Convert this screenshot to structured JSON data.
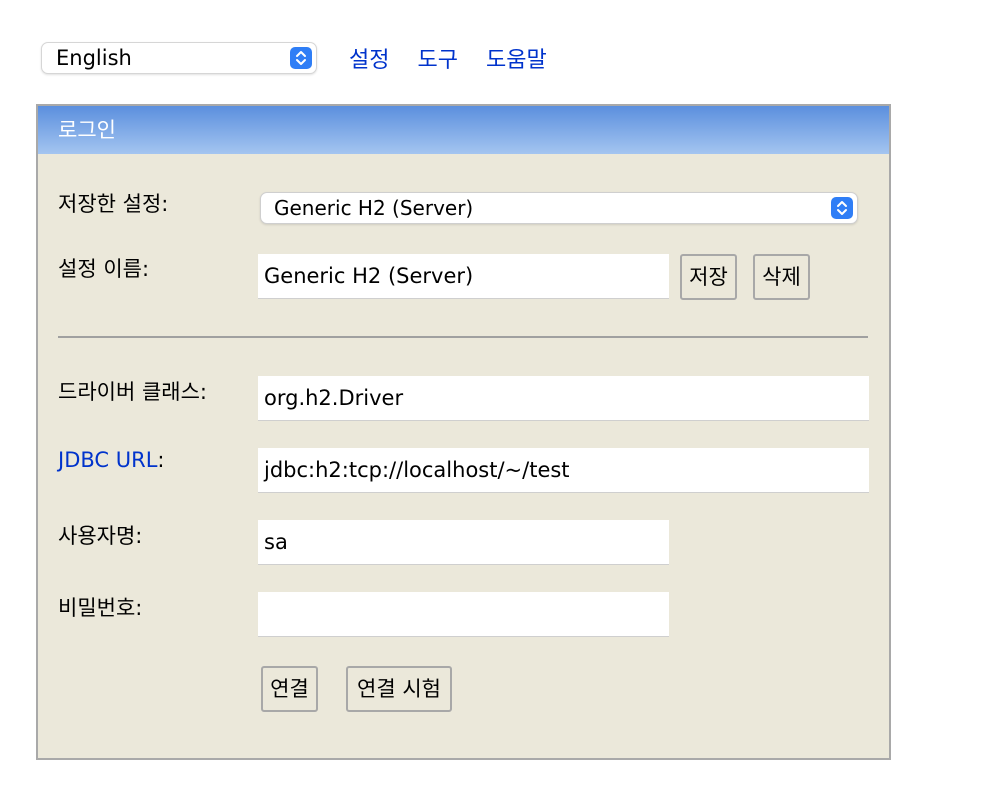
{
  "toolbar": {
    "language": "English",
    "links": [
      "설정",
      "도구",
      "도움말"
    ]
  },
  "panel": {
    "title": "로그인",
    "saved_settings_label": "저장한 설정:",
    "saved_settings_value": "Generic H2 (Server)",
    "setting_name_label": "설정 이름:",
    "setting_name_value": "Generic H2 (Server)",
    "save_button": "저장",
    "delete_button": "삭제",
    "driver_label": "드라이버 클래스:",
    "driver_value": "org.h2.Driver",
    "jdbc_url_label_link": "JDBC URL",
    "jdbc_url_label_suffix": ":",
    "jdbc_url_value": "jdbc:h2:tcp://localhost/~/test",
    "username_label": "사용자명:",
    "username_value": "sa",
    "password_label": "비밀번호:",
    "password_value": "",
    "connect_button": "연결",
    "test_connection_button": "연결 시험"
  },
  "colors": {
    "link": "#0033cc",
    "panel_bg": "#ebe8da",
    "header_top": "#5b8fde",
    "header_bottom": "#a4c5f0",
    "stepper": "#2f7ef6"
  }
}
